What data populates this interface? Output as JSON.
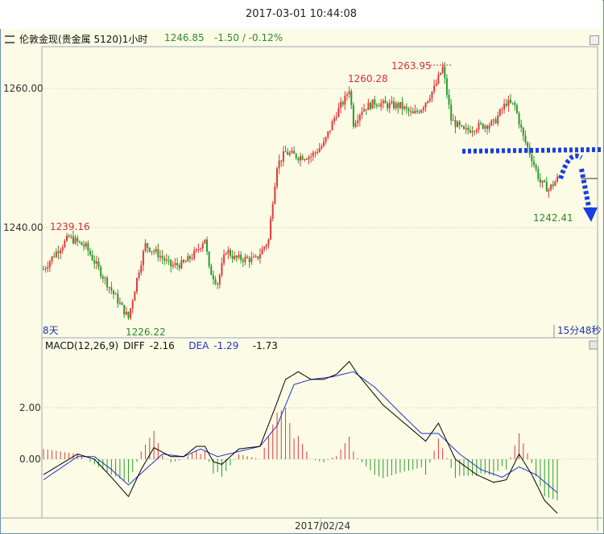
{
  "window": {
    "title": "2017-03-01 10:44:08"
  },
  "header": {
    "symbol": "伦敦金现(贵金属 5120)1小时",
    "price": "1246.85",
    "change": "-1.50 / -0.12%"
  },
  "price_panel": {
    "yticks": [
      "1260.00",
      "1240.00"
    ],
    "annotations": {
      "high1": "1239.16",
      "low1": "1226.22",
      "high2": "1260.28",
      "high3": "1263.95",
      "low2": "1242.41"
    },
    "left_label": "8天",
    "right_label": "15分48秒"
  },
  "macd_panel": {
    "label": "MACD(12,26,9)",
    "diff_label": "DIFF",
    "diff_value": "-2.16",
    "dea_label": "DEA",
    "dea_value": "-1.29",
    "macd_value": "-1.73",
    "yticks": [
      "2.00",
      "0.00"
    ]
  },
  "xaxis": {
    "date_label": "2017/02/24"
  },
  "colors": {
    "up": "#e03a3a",
    "down": "#2a9a2a",
    "diff_line": "#000000",
    "dea_line": "#2233cc",
    "overlay": "#1a3de0"
  },
  "chart_data": [
    {
      "type": "candlestick",
      "title": "伦敦金现(贵金属 5120)1小时",
      "ylim": [
        1224,
        1265
      ],
      "yticks": [
        1240,
        1260
      ],
      "anchors": [
        {
          "x": 0,
          "close": 1234.0
        },
        {
          "x": 6,
          "close": 1236.5
        },
        {
          "x": 12,
          "close": 1238.6
        },
        {
          "x": 20,
          "close": 1237.2
        },
        {
          "x": 28,
          "close": 1233.0
        },
        {
          "x": 34,
          "close": 1230.0
        },
        {
          "x": 40,
          "close": 1227.0
        },
        {
          "x": 45,
          "close": 1234.0
        },
        {
          "x": 48,
          "close": 1237.5
        },
        {
          "x": 54,
          "close": 1236.2
        },
        {
          "x": 60,
          "close": 1234.5
        },
        {
          "x": 66,
          "close": 1234.8
        },
        {
          "x": 72,
          "close": 1236.5
        },
        {
          "x": 76,
          "close": 1238.5
        },
        {
          "x": 78,
          "close": 1234.0
        },
        {
          "x": 82,
          "close": 1232.0
        },
        {
          "x": 86,
          "close": 1236.8
        },
        {
          "x": 90,
          "close": 1235.6
        },
        {
          "x": 100,
          "close": 1235.4
        },
        {
          "x": 106,
          "close": 1238.2
        },
        {
          "x": 108,
          "close": 1244.0
        },
        {
          "x": 110,
          "close": 1249.0
        },
        {
          "x": 114,
          "close": 1250.8
        },
        {
          "x": 120,
          "close": 1250.2
        },
        {
          "x": 126,
          "close": 1250.3
        },
        {
          "x": 132,
          "close": 1252.0
        },
        {
          "x": 138,
          "close": 1256.5
        },
        {
          "x": 142,
          "close": 1258.5
        },
        {
          "x": 144,
          "close": 1260.0
        },
        {
          "x": 146,
          "close": 1255.0
        },
        {
          "x": 150,
          "close": 1257.0
        },
        {
          "x": 156,
          "close": 1258.0
        },
        {
          "x": 162,
          "close": 1257.6
        },
        {
          "x": 168,
          "close": 1257.5
        },
        {
          "x": 174,
          "close": 1256.2
        },
        {
          "x": 178,
          "close": 1257.2
        },
        {
          "x": 184,
          "close": 1260.0
        },
        {
          "x": 188,
          "close": 1263.0
        },
        {
          "x": 192,
          "close": 1255.5
        },
        {
          "x": 198,
          "close": 1253.8
        },
        {
          "x": 204,
          "close": 1254.5
        },
        {
          "x": 212,
          "close": 1255.0
        },
        {
          "x": 218,
          "close": 1258.0
        },
        {
          "x": 222,
          "close": 1257.5
        },
        {
          "x": 226,
          "close": 1253.0
        },
        {
          "x": 230,
          "close": 1250.0
        },
        {
          "x": 234,
          "close": 1246.5
        },
        {
          "x": 238,
          "close": 1245.5
        },
        {
          "x": 242,
          "close": 1247.0
        }
      ]
    },
    {
      "type": "bar+line",
      "title": "MACD(12,26,9)",
      "ylim": [
        -1.8,
        3.5
      ],
      "yticks": [
        0.0,
        2.0
      ],
      "series": [
        {
          "name": "DIFF",
          "anchors": [
            {
              "x": 0,
              "y": -0.6
            },
            {
              "x": 16,
              "y": 0.2
            },
            {
              "x": 24,
              "y": 0.0
            },
            {
              "x": 32,
              "y": -0.7
            },
            {
              "x": 40,
              "y": -1.45
            },
            {
              "x": 46,
              "y": -0.4
            },
            {
              "x": 52,
              "y": 0.45
            },
            {
              "x": 60,
              "y": 0.1
            },
            {
              "x": 66,
              "y": 0.1
            },
            {
              "x": 72,
              "y": 0.5
            },
            {
              "x": 76,
              "y": 0.5
            },
            {
              "x": 80,
              "y": -0.1
            },
            {
              "x": 84,
              "y": -0.2
            },
            {
              "x": 92,
              "y": 0.4
            },
            {
              "x": 102,
              "y": 0.5
            },
            {
              "x": 110,
              "y": 2.2
            },
            {
              "x": 114,
              "y": 3.1
            },
            {
              "x": 120,
              "y": 3.4
            },
            {
              "x": 126,
              "y": 3.1
            },
            {
              "x": 132,
              "y": 3.1
            },
            {
              "x": 138,
              "y": 3.3
            },
            {
              "x": 144,
              "y": 3.8
            },
            {
              "x": 148,
              "y": 3.3
            },
            {
              "x": 160,
              "y": 2.1
            },
            {
              "x": 170,
              "y": 1.4
            },
            {
              "x": 180,
              "y": 0.7
            },
            {
              "x": 186,
              "y": 1.4
            },
            {
              "x": 194,
              "y": 0.0
            },
            {
              "x": 204,
              "y": -0.6
            },
            {
              "x": 212,
              "y": -0.9
            },
            {
              "x": 218,
              "y": -0.8
            },
            {
              "x": 224,
              "y": 0.2
            },
            {
              "x": 230,
              "y": -0.6
            },
            {
              "x": 236,
              "y": -1.6
            },
            {
              "x": 242,
              "y": -2.1
            }
          ]
        },
        {
          "name": "DEA",
          "anchors": [
            {
              "x": 0,
              "y": -0.8
            },
            {
              "x": 16,
              "y": 0.1
            },
            {
              "x": 24,
              "y": 0.1
            },
            {
              "x": 32,
              "y": -0.4
            },
            {
              "x": 40,
              "y": -1.0
            },
            {
              "x": 48,
              "y": -0.4
            },
            {
              "x": 56,
              "y": 0.2
            },
            {
              "x": 66,
              "y": 0.1
            },
            {
              "x": 74,
              "y": 0.4
            },
            {
              "x": 82,
              "y": 0.1
            },
            {
              "x": 92,
              "y": 0.3
            },
            {
              "x": 102,
              "y": 0.5
            },
            {
              "x": 110,
              "y": 1.3
            },
            {
              "x": 118,
              "y": 2.9
            },
            {
              "x": 126,
              "y": 3.1
            },
            {
              "x": 136,
              "y": 3.2
            },
            {
              "x": 146,
              "y": 3.4
            },
            {
              "x": 156,
              "y": 2.8
            },
            {
              "x": 168,
              "y": 1.8
            },
            {
              "x": 178,
              "y": 1.0
            },
            {
              "x": 186,
              "y": 1.0
            },
            {
              "x": 196,
              "y": 0.2
            },
            {
              "x": 206,
              "y": -0.4
            },
            {
              "x": 216,
              "y": -0.7
            },
            {
              "x": 224,
              "y": -0.3
            },
            {
              "x": 232,
              "y": -0.6
            },
            {
              "x": 242,
              "y": -1.3
            }
          ]
        }
      ]
    }
  ]
}
